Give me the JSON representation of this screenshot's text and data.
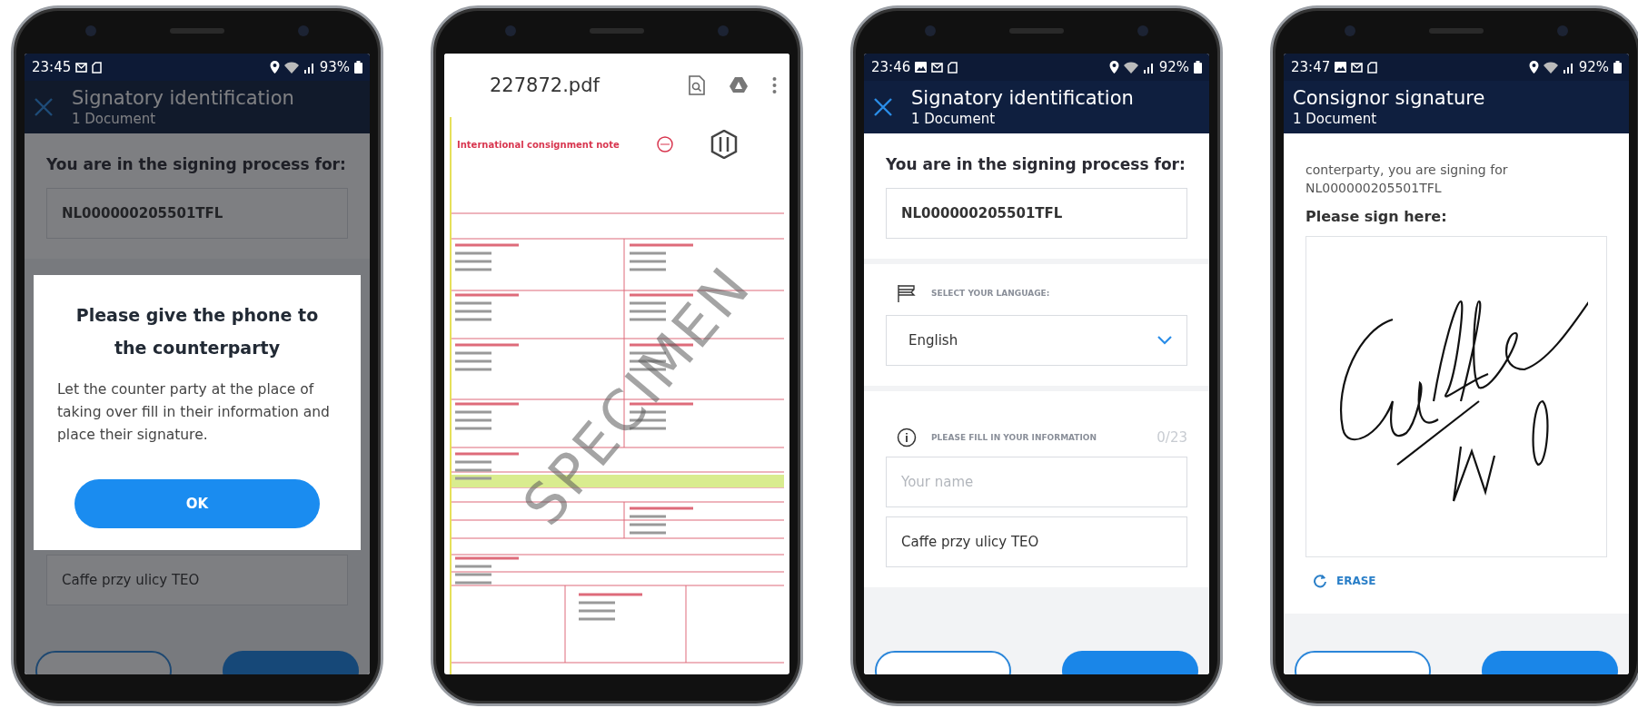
{
  "phones": [
    {
      "kind": "identification",
      "status_bar": {
        "time": "23:45",
        "notification_icons": [
          {
            "kind": "mail"
          },
          {
            "kind": "sim"
          }
        ],
        "battery": "93%"
      },
      "header": {
        "title": "Signatory identification",
        "subtitle": "1 Document",
        "closable": true
      },
      "prompt": "You are in the signing process for:",
      "reference": "NL000000205501TFL",
      "fields": [
        {
          "value": "Caffe przy ulicy TEO"
        }
      ],
      "dialog": {
        "title": "Please give the phone to the counterparty",
        "message": "Let the counter party at the place of taking over fill in their information and place their signature.",
        "button": "OK"
      }
    },
    {
      "kind": "pdf_viewer",
      "file_name": "227872.pdf",
      "document": {
        "title": "International consignment note",
        "stamp": "SPECIMEN"
      }
    },
    {
      "kind": "identification",
      "status_bar": {
        "time": "23:46",
        "notification_icons": [
          {
            "kind": "image"
          },
          {
            "kind": "mail"
          },
          {
            "kind": "sim"
          }
        ],
        "battery": "92%"
      },
      "header": {
        "title": "Signatory identification",
        "subtitle": "1 Document",
        "closable": true
      },
      "prompt": "You are in the signing process for:",
      "reference": "NL000000205501TFL",
      "language": {
        "label": "SELECT YOUR LANGUAGE:",
        "value": "English"
      },
      "information": {
        "label": "PLEASE FILL IN YOUR INFORMATION",
        "counter": "0/23"
      },
      "fields": [
        {
          "placeholder": "Your name"
        },
        {
          "value": "Caffe przy ulicy TEO"
        }
      ]
    },
    {
      "kind": "signature",
      "status_bar": {
        "time": "23:47",
        "notification_icons": [
          {
            "kind": "image"
          },
          {
            "kind": "mail"
          },
          {
            "kind": "sim"
          }
        ],
        "battery": "92%"
      },
      "header": {
        "title": "Consignor signature",
        "subtitle": "1 Document",
        "closable": false
      },
      "message": "conterparty, you are signing for NL000000205501TFL",
      "sign_label": "Please sign here:",
      "erase": "ERASE"
    }
  ]
}
